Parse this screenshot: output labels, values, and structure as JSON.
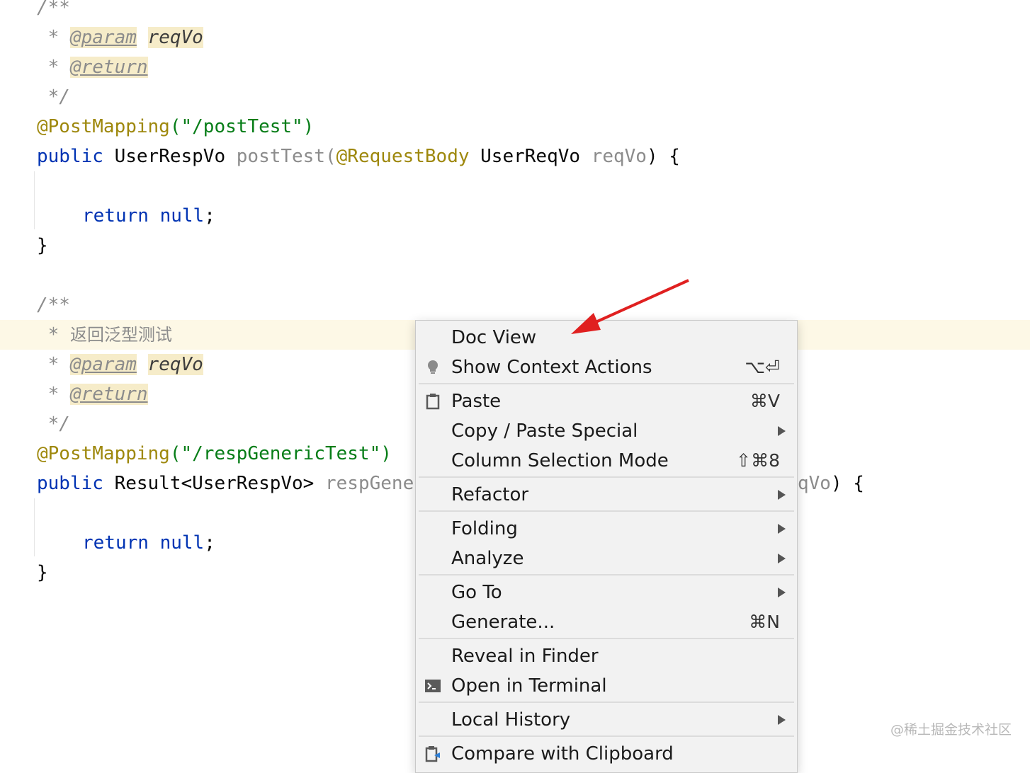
{
  "code": {
    "block1": {
      "doc_open": "/**",
      "param_prefix": " * ",
      "param_tag": "@param",
      "param_name": "reqVo",
      "return_prefix": " * ",
      "return_tag": "@return",
      "doc_close": " */",
      "annotation": "@PostMapping",
      "annotation_arg": "(\"/postTest\")",
      "sig_kw": "public",
      "sig_type": " UserRespVo ",
      "sig_method": "postTest(",
      "sig_param_ann": "@RequestBody",
      "sig_param_type": " UserReqVo ",
      "sig_param_name": "reqVo",
      "sig_tail": ") {",
      "ret_kw": "return",
      "ret_val": " null",
      "ret_end": ";",
      "close": "}"
    },
    "block2": {
      "doc_open": "/**",
      "desc_prefix": " * ",
      "desc_text": "返回泛型测试",
      "param_prefix": " * ",
      "param_tag": "@param",
      "param_name": "reqVo",
      "return_prefix": " * ",
      "return_tag": "@return",
      "doc_close": " */",
      "annotation": "@PostMapping",
      "annotation_arg": "(\"/respGenericTest\")",
      "sig_kw": "public",
      "sig_type": " Result<UserRespVo> ",
      "sig_method": "respGene",
      "sig_tail_visible": "qVo) {",
      "ret_kw": "return",
      "ret_val": " null",
      "ret_end": ";",
      "close": "}"
    }
  },
  "context_menu": {
    "items": [
      {
        "label": "Doc View"
      },
      {
        "label": "Show Context Actions",
        "shortcut": "⌥⏎",
        "icon": "lightbulb-icon"
      },
      {
        "label": "Paste",
        "shortcut": "⌘V",
        "icon": "clipboard-icon"
      },
      {
        "label": "Copy / Paste Special",
        "submenu": true
      },
      {
        "label": "Column Selection Mode",
        "shortcut": "⇧⌘8"
      },
      {
        "label": "Refactor",
        "submenu": true
      },
      {
        "label": "Folding",
        "submenu": true
      },
      {
        "label": "Analyze",
        "submenu": true
      },
      {
        "label": "Go To",
        "submenu": true
      },
      {
        "label": "Generate...",
        "shortcut": "⌘N"
      },
      {
        "label": "Reveal in Finder"
      },
      {
        "label": "Open in Terminal",
        "icon": "terminal-icon"
      },
      {
        "label": "Local History",
        "submenu": true
      },
      {
        "label": "Compare with Clipboard",
        "icon": "compare-clipboard-icon"
      }
    ]
  },
  "annotation_arrow_color": "#e02020",
  "watermark": "@稀土掘金技术社区"
}
